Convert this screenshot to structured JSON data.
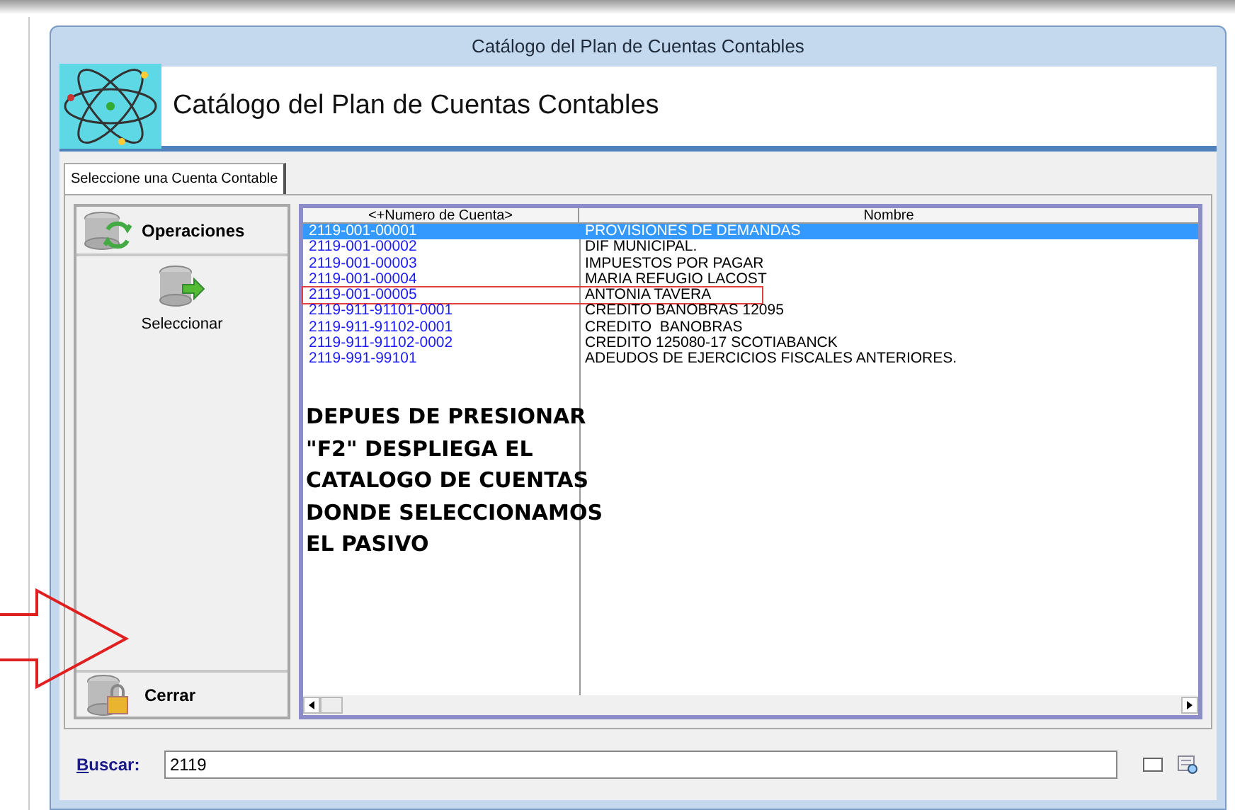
{
  "window": {
    "title": "Catálogo del Plan de Cuentas Contables"
  },
  "header": {
    "title": "Catálogo del Plan de Cuentas Contables"
  },
  "tabs": [
    {
      "label": "Seleccione una Cuenta Contable",
      "selected": true
    }
  ],
  "sidebar": {
    "section": "Operaciones",
    "items": [
      {
        "label": "Seleccionar"
      }
    ],
    "footer": "Cerrar"
  },
  "table": {
    "columns": [
      "<+Numero de Cuenta>",
      "Nombre"
    ],
    "rows": [
      {
        "account": "2119-001-00001",
        "name": "PROVISIONES DE DEMANDAS",
        "selected": true,
        "highlighted": false
      },
      {
        "account": "2119-001-00002",
        "name": "DIF MUNICIPAL.",
        "selected": false,
        "highlighted": false
      },
      {
        "account": "2119-001-00003",
        "name": "IMPUESTOS POR PAGAR",
        "selected": false,
        "highlighted": false
      },
      {
        "account": "2119-001-00004",
        "name": "MARIA REFUGIO LACOST",
        "selected": false,
        "highlighted": false
      },
      {
        "account": "2119-001-00005",
        "name": "ANTONIA TAVERA",
        "selected": false,
        "highlighted": true
      },
      {
        "account": "2119-911-91101-0001",
        "name": "CREDITO BANOBRAS 12095",
        "selected": false,
        "highlighted": false
      },
      {
        "account": "2119-911-91102-0001",
        "name": "CREDITO  BANOBRAS",
        "selected": false,
        "highlighted": false
      },
      {
        "account": "2119-911-91102-0002",
        "name": "CREDITO 125080-17 SCOTIABANCK",
        "selected": false,
        "highlighted": false
      },
      {
        "account": "2119-991-99101",
        "name": "ADEUDOS DE EJERCICIOS FISCALES ANTERIORES.",
        "selected": false,
        "highlighted": false
      }
    ]
  },
  "annotation": {
    "lines": [
      "DEPUES DE PRESIONAR",
      "\"F2\" DESPLIEGA EL",
      "CATALOGO DE CUENTAS",
      "DONDE SELECCIONAMOS",
      "EL PASIVO"
    ]
  },
  "search": {
    "label": "Buscar:",
    "value": "2119",
    "checked": false
  }
}
